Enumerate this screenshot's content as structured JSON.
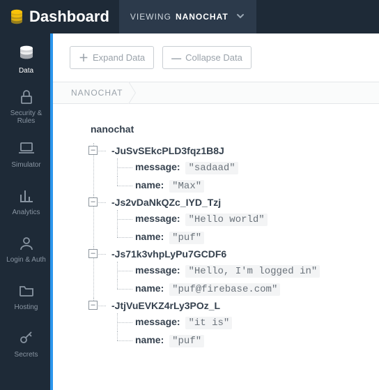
{
  "topbar": {
    "title": "Dashboard",
    "viewing_label": "VIEWING",
    "app_name": "NANOCHAT"
  },
  "sidebar": {
    "items": [
      {
        "id": "data",
        "label": "Data",
        "active": true
      },
      {
        "id": "security",
        "label": "Security & Rules",
        "active": false
      },
      {
        "id": "simulator",
        "label": "Simulator",
        "active": false
      },
      {
        "id": "analytics",
        "label": "Analytics",
        "active": false
      },
      {
        "id": "login",
        "label": "Login & Auth",
        "active": false
      },
      {
        "id": "hosting",
        "label": "Hosting",
        "active": false
      },
      {
        "id": "secrets",
        "label": "Secrets",
        "active": false
      }
    ]
  },
  "toolbar": {
    "expand_label": "Expand Data",
    "collapse_label": "Collapse Data"
  },
  "breadcrumb": {
    "root": "NANOCHAT"
  },
  "tree": {
    "root": "nanochat",
    "nodes": [
      {
        "key": "-JuSvSEkcPLD3fqz1B8J",
        "fields": {
          "message": "\"sadaad\"",
          "name": "\"Max\""
        }
      },
      {
        "key": "-Js2vDaNkQZc_IYD_Tzj",
        "fields": {
          "message": "\"Hello world\"",
          "name": "\"puf\""
        }
      },
      {
        "key": "-Js71k3vhpLyPu7GCDF6",
        "fields": {
          "message": "\"Hello, I'm logged in\"",
          "name": "\"puf@firebase.com\""
        }
      },
      {
        "key": "-JtjVuEVKZ4rLy3POz_L",
        "fields": {
          "message": "\"it is\"",
          "name": "\"puf\""
        }
      }
    ],
    "field_label_message": "message:",
    "field_label_name": "name:",
    "toggle_glyph": "–"
  }
}
